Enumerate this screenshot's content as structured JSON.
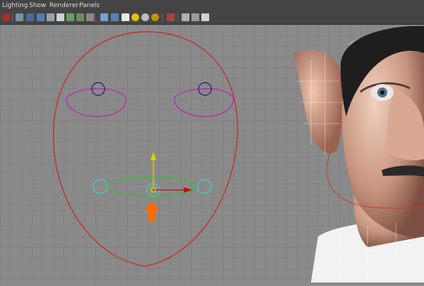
{
  "menubar": {
    "items": [
      {
        "label": "Lighting"
      },
      {
        "label": "Show"
      },
      {
        "label": "Renderer"
      },
      {
        "label": "Panels"
      }
    ]
  },
  "toolbar": {
    "icons": [
      "select-camera-icon",
      "wireframe-icon",
      "smooth-shade-icon",
      "shaded-icon",
      "textured-icon",
      "lights-icon",
      "uv-icon",
      "text-icon",
      "camera-icon",
      "cube-icon",
      "grid-icon",
      "sphere-icon",
      "ball-icon",
      "light-bulb-icon",
      "isolate-icon",
      "xray-icon",
      "layout-icon"
    ]
  },
  "viewport": {
    "grid": true,
    "background": "#8a8a8a",
    "grid_color": "#7a7a7a",
    "colors": {
      "head_outline": "#d02020",
      "eye_curve": "#c020b0",
      "eye_locator": "#1a1a7a",
      "mouth_curve": "#30c030",
      "mouth_locator": "#3fd0d0",
      "move_x": "#c01010",
      "move_y": "#e0d000",
      "arrow_indicator": "#ff6a00"
    }
  }
}
